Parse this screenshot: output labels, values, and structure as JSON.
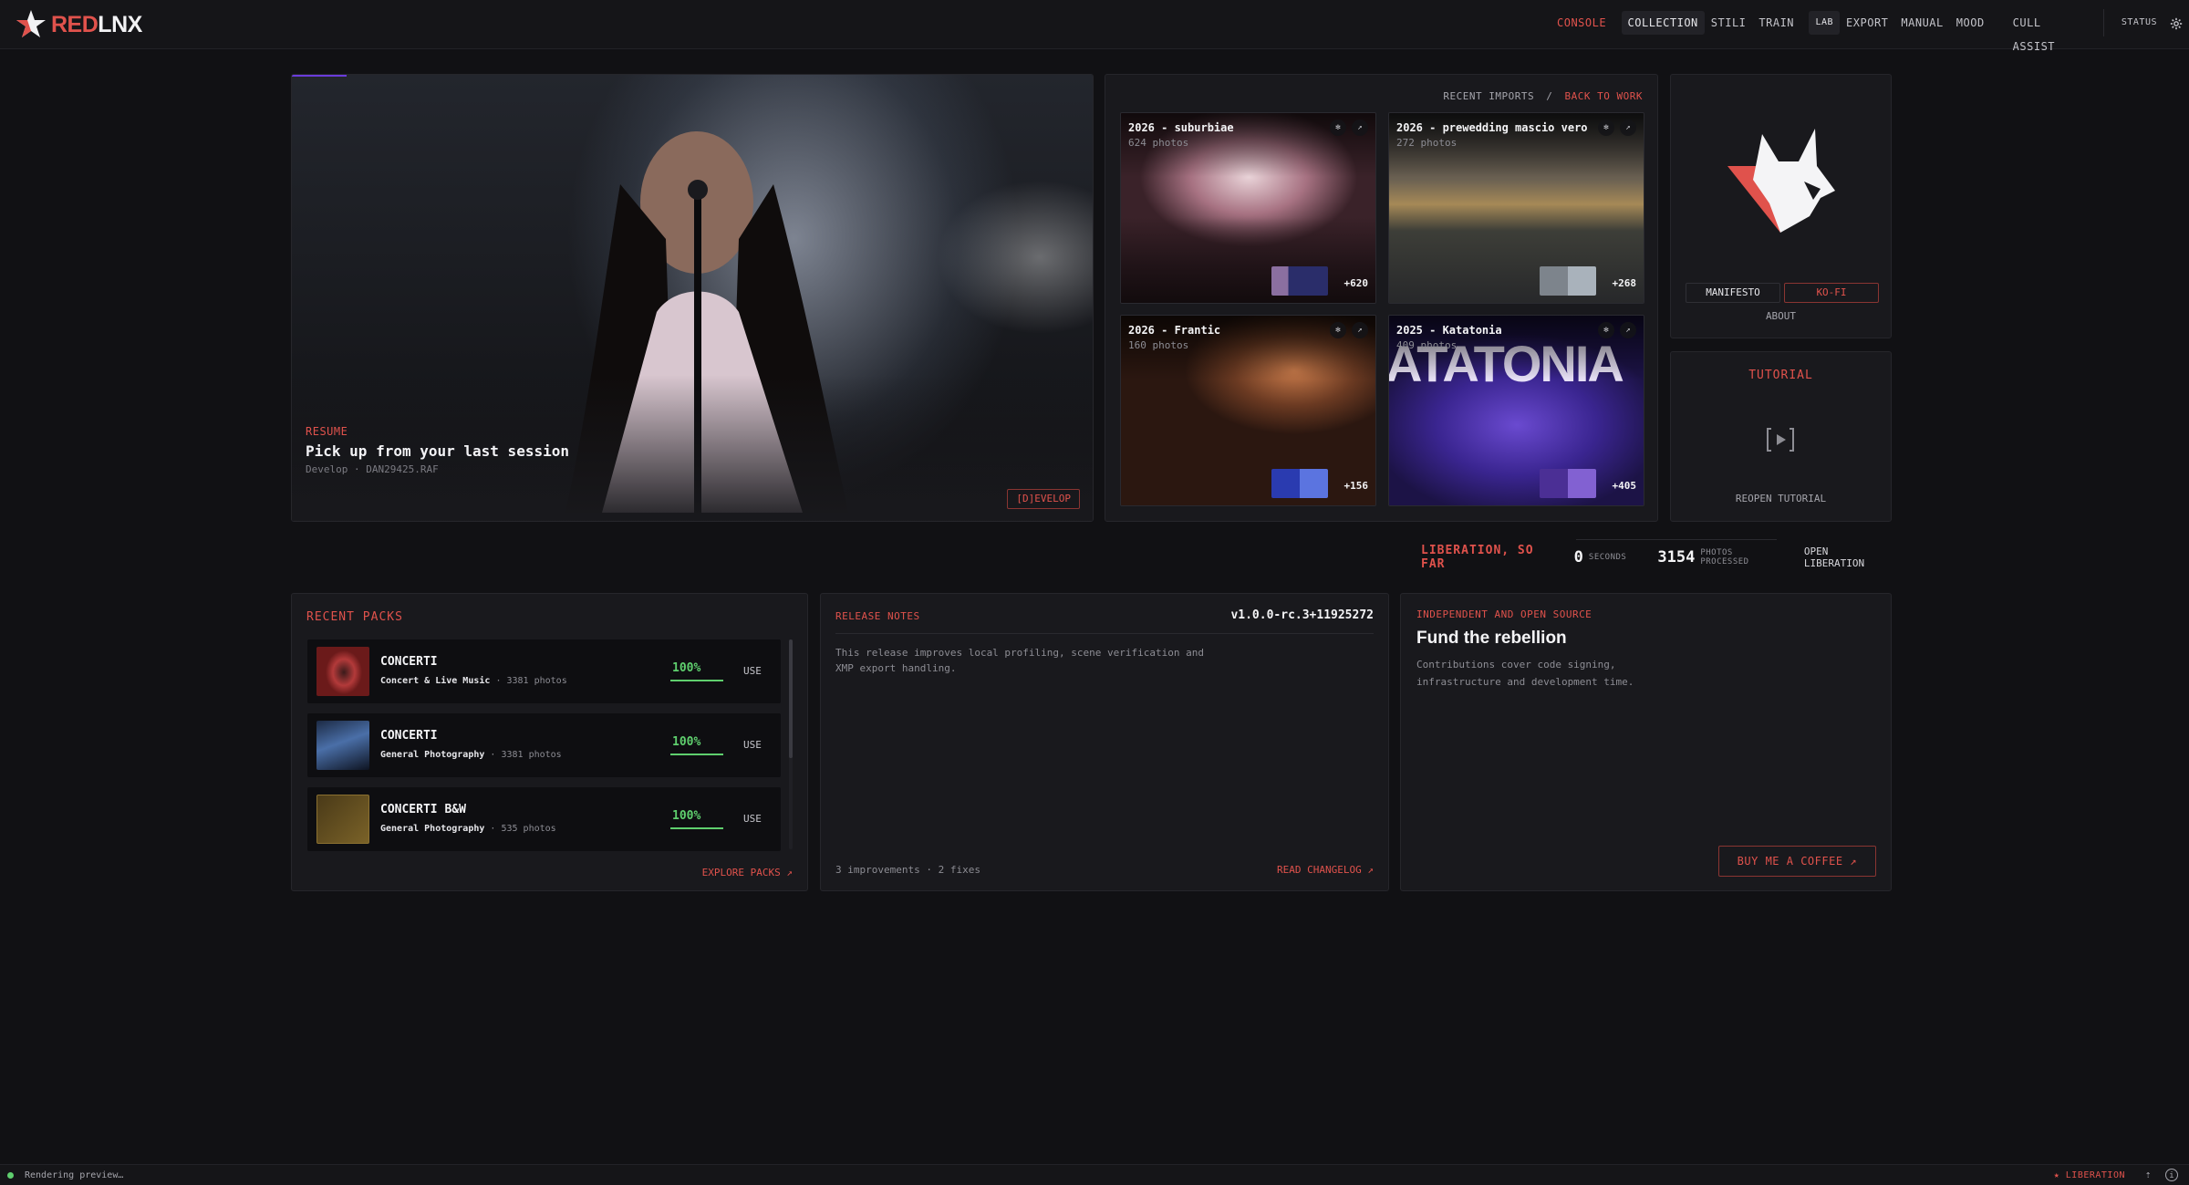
{
  "brand": {
    "name_a": "RED",
    "name_b": "LNX"
  },
  "nav": {
    "console": "CONSOLE",
    "group1": [
      "COLLECTION",
      "STILI",
      "TRAIN"
    ],
    "group2": [
      "LAB",
      "EXPORT",
      "MANUAL",
      "MOOD"
    ],
    "cull": "CULL ASSIST",
    "status": "STATUS"
  },
  "hero": {
    "kicker": "RESUME",
    "title": "Pick up from your last session",
    "subtitle": "Develop · DAN29425.RAF",
    "button": "[D]EVELOP"
  },
  "imports": {
    "label": "RECENT IMPORTS",
    "sep": "/",
    "link": "BACK TO WORK",
    "cards": [
      {
        "title": "2026 - suburbiae",
        "count": "624 photos",
        "more": "+620"
      },
      {
        "title": "2026 - prewedding mascio vero",
        "count": "272 photos",
        "more": "+268"
      },
      {
        "title": "2026 - Frantic",
        "count": "160 photos",
        "more": "+156"
      },
      {
        "title": "2025 - Katatonia",
        "count": "409 photos",
        "more": "+405",
        "overlay_text": "ATATONIA"
      }
    ]
  },
  "about": {
    "manifesto": "MANIFESTO",
    "kofi": "KO-FI",
    "about": "ABOUT"
  },
  "tutorial": {
    "title": "TUTORIAL",
    "reopen": "REOPEN TUTORIAL"
  },
  "liberation": {
    "label": "LIBERATION, SO FAR",
    "seconds": "0",
    "seconds_unit": "SECONDS",
    "photos": "3154",
    "photos_unit": "PHOTOS PROCESSED",
    "open": "OPEN LIBERATION"
  },
  "packs": {
    "title": "RECENT PACKS",
    "items": [
      {
        "name": "CONCERTI",
        "category": "Concert & Live Music",
        "photos": "· 3381 photos",
        "progress": "100%",
        "progress_fraction": 1.0,
        "use": "USE"
      },
      {
        "name": "CONCERTI",
        "category": "General Photography",
        "photos": "· 3381 photos",
        "progress": "100%",
        "progress_fraction": 1.0,
        "use": "USE"
      },
      {
        "name": "CONCERTI B&W",
        "category": "General Photography",
        "photos": "· 535 photos",
        "progress": "100%",
        "progress_fraction": 1.0,
        "use": "USE"
      }
    ],
    "explore": "EXPLORE PACKS ↗"
  },
  "release": {
    "title": "RELEASE NOTES",
    "version": "v1.0.0-rc.3+11925272",
    "body": "This release improves local profiling, scene verification and XMP export handling.",
    "count": "3 improvements · 2 fixes",
    "changelog": "READ CHANGELOG ↗"
  },
  "fund": {
    "kicker": "INDEPENDENT AND OPEN SOURCE",
    "title": "Fund the rebellion",
    "body": "Contributions cover code signing, infrastructure and development time.",
    "button": "BUY ME A COFFEE ↗"
  },
  "statusbar": {
    "message": "Rendering preview…",
    "liberation": "★ LIBERATION"
  },
  "colors": {
    "accent": "#e0524c",
    "success": "#5fcf6e",
    "background": "#111114",
    "panel": "#19191d"
  },
  "icons": {
    "settings": "gear-icon",
    "play": "play-icon",
    "lynx": "lynx-logo-icon"
  }
}
